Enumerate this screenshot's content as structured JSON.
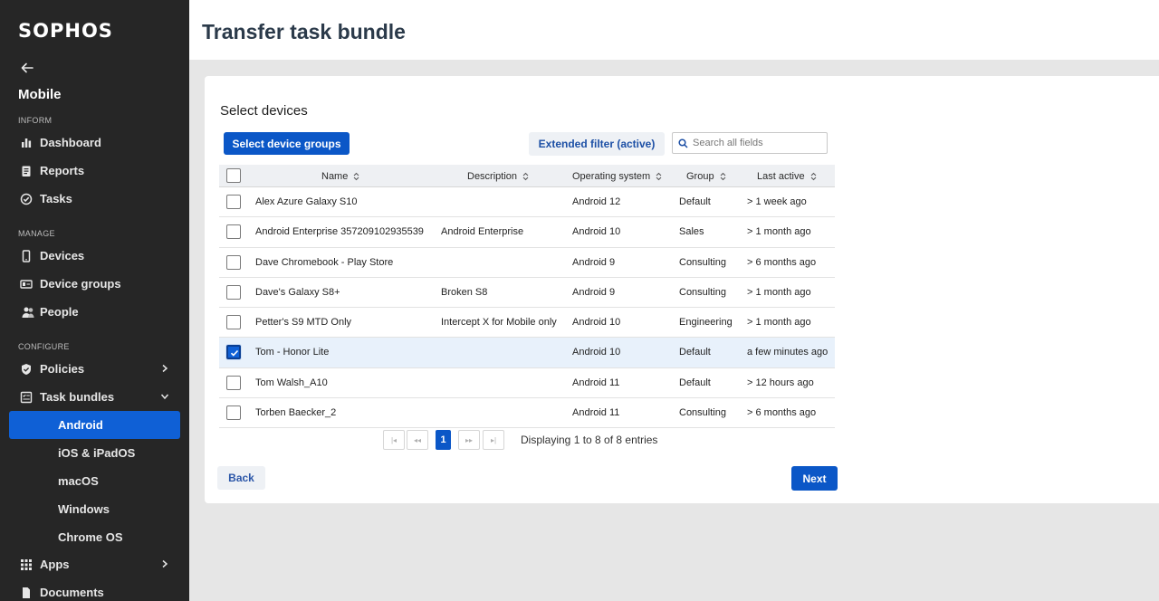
{
  "sidebar": {
    "logo": "SOPHOS",
    "app_title": "Mobile",
    "sections": {
      "inform": "INFORM",
      "manage": "MANAGE",
      "configure": "CONFIGURE"
    },
    "items": {
      "dashboard": "Dashboard",
      "reports": "Reports",
      "tasks": "Tasks",
      "devices": "Devices",
      "device_groups": "Device groups",
      "people": "People",
      "policies": "Policies",
      "task_bundles": "Task bundles",
      "apps": "Apps",
      "documents": "Documents"
    },
    "task_bundle_sub": [
      "Android",
      "iOS & iPadOS",
      "macOS",
      "Windows",
      "Chrome OS"
    ]
  },
  "header": {
    "title": "Transfer task bundle"
  },
  "main": {
    "section_title": "Select devices",
    "select_groups_label": "Select device groups",
    "filter_label": "Extended filter (active)",
    "search_placeholder": "Search all fields",
    "columns": [
      "Name",
      "Description",
      "Operating system",
      "Group",
      "Last active"
    ],
    "rows": [
      {
        "name": "Alex Azure Galaxy S10",
        "description": "",
        "os": "Android 12",
        "group": "Default",
        "last": "> 1 week ago",
        "checked": false
      },
      {
        "name": "Android Enterprise 357209102935539",
        "description": "Android Enterprise",
        "os": "Android 10",
        "group": "Sales",
        "last": "> 1 month ago",
        "checked": false
      },
      {
        "name": "Dave Chromebook - Play Store",
        "description": "",
        "os": "Android 9",
        "group": "Consulting",
        "last": "> 6 months ago",
        "checked": false
      },
      {
        "name": "Dave's Galaxy S8+",
        "description": "Broken S8",
        "os": "Android 9",
        "group": "Consulting",
        "last": "> 1 month ago",
        "checked": false
      },
      {
        "name": "Petter's S9 MTD Only",
        "description": "Intercept X for Mobile only",
        "os": "Android 10",
        "group": "Engineering",
        "last": "> 1 month ago",
        "checked": false
      },
      {
        "name": "Tom - Honor Lite",
        "description": "",
        "os": "Android 10",
        "group": "Default",
        "last": "a few minutes ago",
        "checked": true
      },
      {
        "name": "Tom Walsh_A10",
        "description": "",
        "os": "Android 11",
        "group": "Default",
        "last": "> 12 hours ago",
        "checked": false
      },
      {
        "name": "Torben Baecker_2",
        "description": "",
        "os": "Android 11",
        "group": "Consulting",
        "last": "> 6 months ago",
        "checked": false
      }
    ],
    "pagination": {
      "first": "|◂",
      "prev": "◂◂",
      "current": "1",
      "next": "▸▸",
      "last": "▸|",
      "info": "Displaying 1 to 8 of 8 entries"
    },
    "back_label": "Back",
    "next_label": "Next"
  },
  "colors": {
    "accent": "#0b57c7",
    "sidebar_bg": "#262626",
    "active_nav": "#0f60d6"
  }
}
